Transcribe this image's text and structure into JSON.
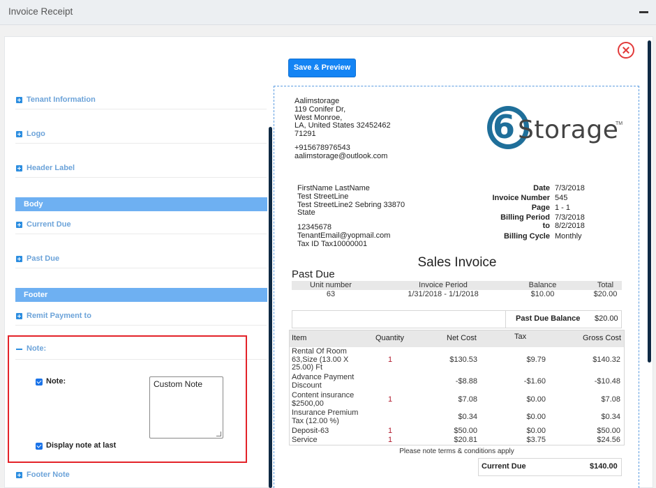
{
  "window": {
    "title": "Invoice Receipt"
  },
  "toolbar": {
    "save_preview_label": "Save & Preview"
  },
  "sidebar": {
    "tenant_information": "Tenant Information",
    "logo": "Logo",
    "header_label": "Header Label",
    "body_section": "Body",
    "current_due": "Current Due",
    "past_due": "Past Due",
    "footer_section": "Footer",
    "remit_payment": "Remit Payment to",
    "note": "Note:",
    "footer_note": "Footer Note"
  },
  "note_panel": {
    "note_checkbox_label": "Note:",
    "note_checked": true,
    "note_text": "Custom Note",
    "display_last_label": "Display note at last",
    "display_last_checked": true
  },
  "invoice": {
    "company": {
      "name": "Aalimstorage",
      "address1": "119 Conifer Dr,",
      "city": "West Monroe,",
      "state_line": "LA, United States 32452462",
      "zip": "71291",
      "phone": "+915678976543",
      "email": "aalimstorage@outlook.com"
    },
    "logo": {
      "six": "6",
      "word": "Storage",
      "tm": "TM",
      "icon": "6storage-logo"
    },
    "tenant": {
      "name": "FirstName LastName",
      "street1": "Test StreetLine",
      "street2": "Test StreetLine2 Sebring 33870",
      "state": "State",
      "phone": "12345678",
      "email": "TenantEmail@yopmail.com",
      "tax_id": "Tax ID Tax10000001"
    },
    "meta": {
      "date_label": "Date",
      "date_value": "7/3/2018",
      "invoice_number_label": "Invoice Number",
      "invoice_number_value": "545",
      "page_label": "Page",
      "page_value": "1 - 1",
      "billing_period_label": "Billing Period",
      "billing_period_start": "7/3/2018",
      "billing_period_to_label": "to",
      "billing_period_end": "8/2/2018",
      "billing_cycle_label": "Billing Cycle",
      "billing_cycle_value": "Monthly"
    },
    "sales_title": "Sales Invoice",
    "past_due_title": "Past Due",
    "past_due_table": {
      "headers": [
        "Unit number",
        "Invoice Period",
        "Balance",
        "Total"
      ],
      "row": [
        "63",
        "1/31/2018 - 1/1/2018",
        "$10.00",
        "$20.00"
      ]
    },
    "past_due_balance": {
      "label": "Past Due Balance",
      "value": "$20.00"
    },
    "items_table": {
      "headers": [
        "Item",
        "Quantity",
        "Net Cost",
        "Tax",
        "Gross Cost"
      ],
      "rows": [
        {
          "item": "Rental Of Room\n63,Size (13.00 X\n25.00) Ft",
          "qty": "1",
          "net": "$130.53",
          "tax": "$9.79",
          "gross": "$140.32"
        },
        {
          "item": "Advance Payment\nDiscount",
          "qty": "",
          "net": "-$8.88",
          "tax": "-$1.60",
          "gross": "-$10.48"
        },
        {
          "item": "Content insurance\n$2500,00",
          "qty": "1",
          "net": "$7.08",
          "tax": "$0.00",
          "gross": "$7.08"
        },
        {
          "item": "Insurance Premium\nTax (12.00 %)",
          "qty": "",
          "net": "$0.34",
          "tax": "$0.00",
          "gross": "$0.34"
        },
        {
          "item": "Deposit-63",
          "qty": "1",
          "net": "$50.00",
          "tax": "$0.00",
          "gross": "$50.00"
        },
        {
          "item": "Service",
          "qty": "1",
          "net": "$20.81",
          "tax": "$3.75",
          "gross": "$24.56"
        }
      ]
    },
    "terms": "Please note terms & conditions apply",
    "current_due": {
      "label": "Current Due",
      "value": "$140.00"
    }
  }
}
